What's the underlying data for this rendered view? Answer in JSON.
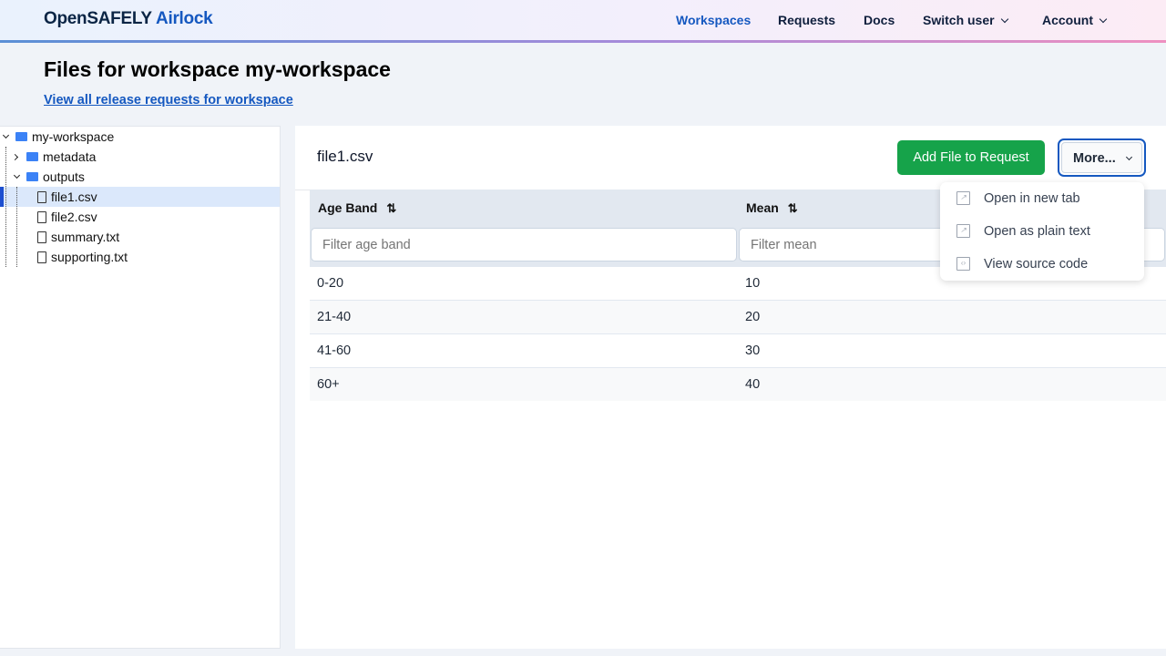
{
  "header": {
    "logo_main": "OpenSAFELY",
    "logo_accent": "Airlock",
    "nav": [
      "Workspaces",
      "Requests",
      "Docs",
      "Switch user",
      "Account"
    ]
  },
  "page": {
    "title": "Files for workspace my-workspace",
    "requests_link": "View all release requests for workspace"
  },
  "tree": {
    "root": "my-workspace",
    "folders": [
      "metadata",
      "outputs"
    ],
    "files": [
      "file1.csv",
      "file2.csv",
      "summary.txt",
      "supporting.txt"
    ]
  },
  "file": {
    "name": "file1.csv",
    "add_button": "Add File to Request",
    "more_button": "More..."
  },
  "menu": [
    "Open in new tab",
    "Open as plain text",
    "View source code"
  ],
  "table": {
    "headers": [
      "Age Band",
      "Mean"
    ],
    "filters": [
      "Filter age band",
      "Filter mean"
    ],
    "rows": [
      [
        "0-20",
        "10"
      ],
      [
        "21-40",
        "20"
      ],
      [
        "41-60",
        "30"
      ],
      [
        "60+",
        "40"
      ]
    ]
  },
  "colors": {
    "accent": "#1558c0",
    "primary_button": "#16a34a"
  }
}
